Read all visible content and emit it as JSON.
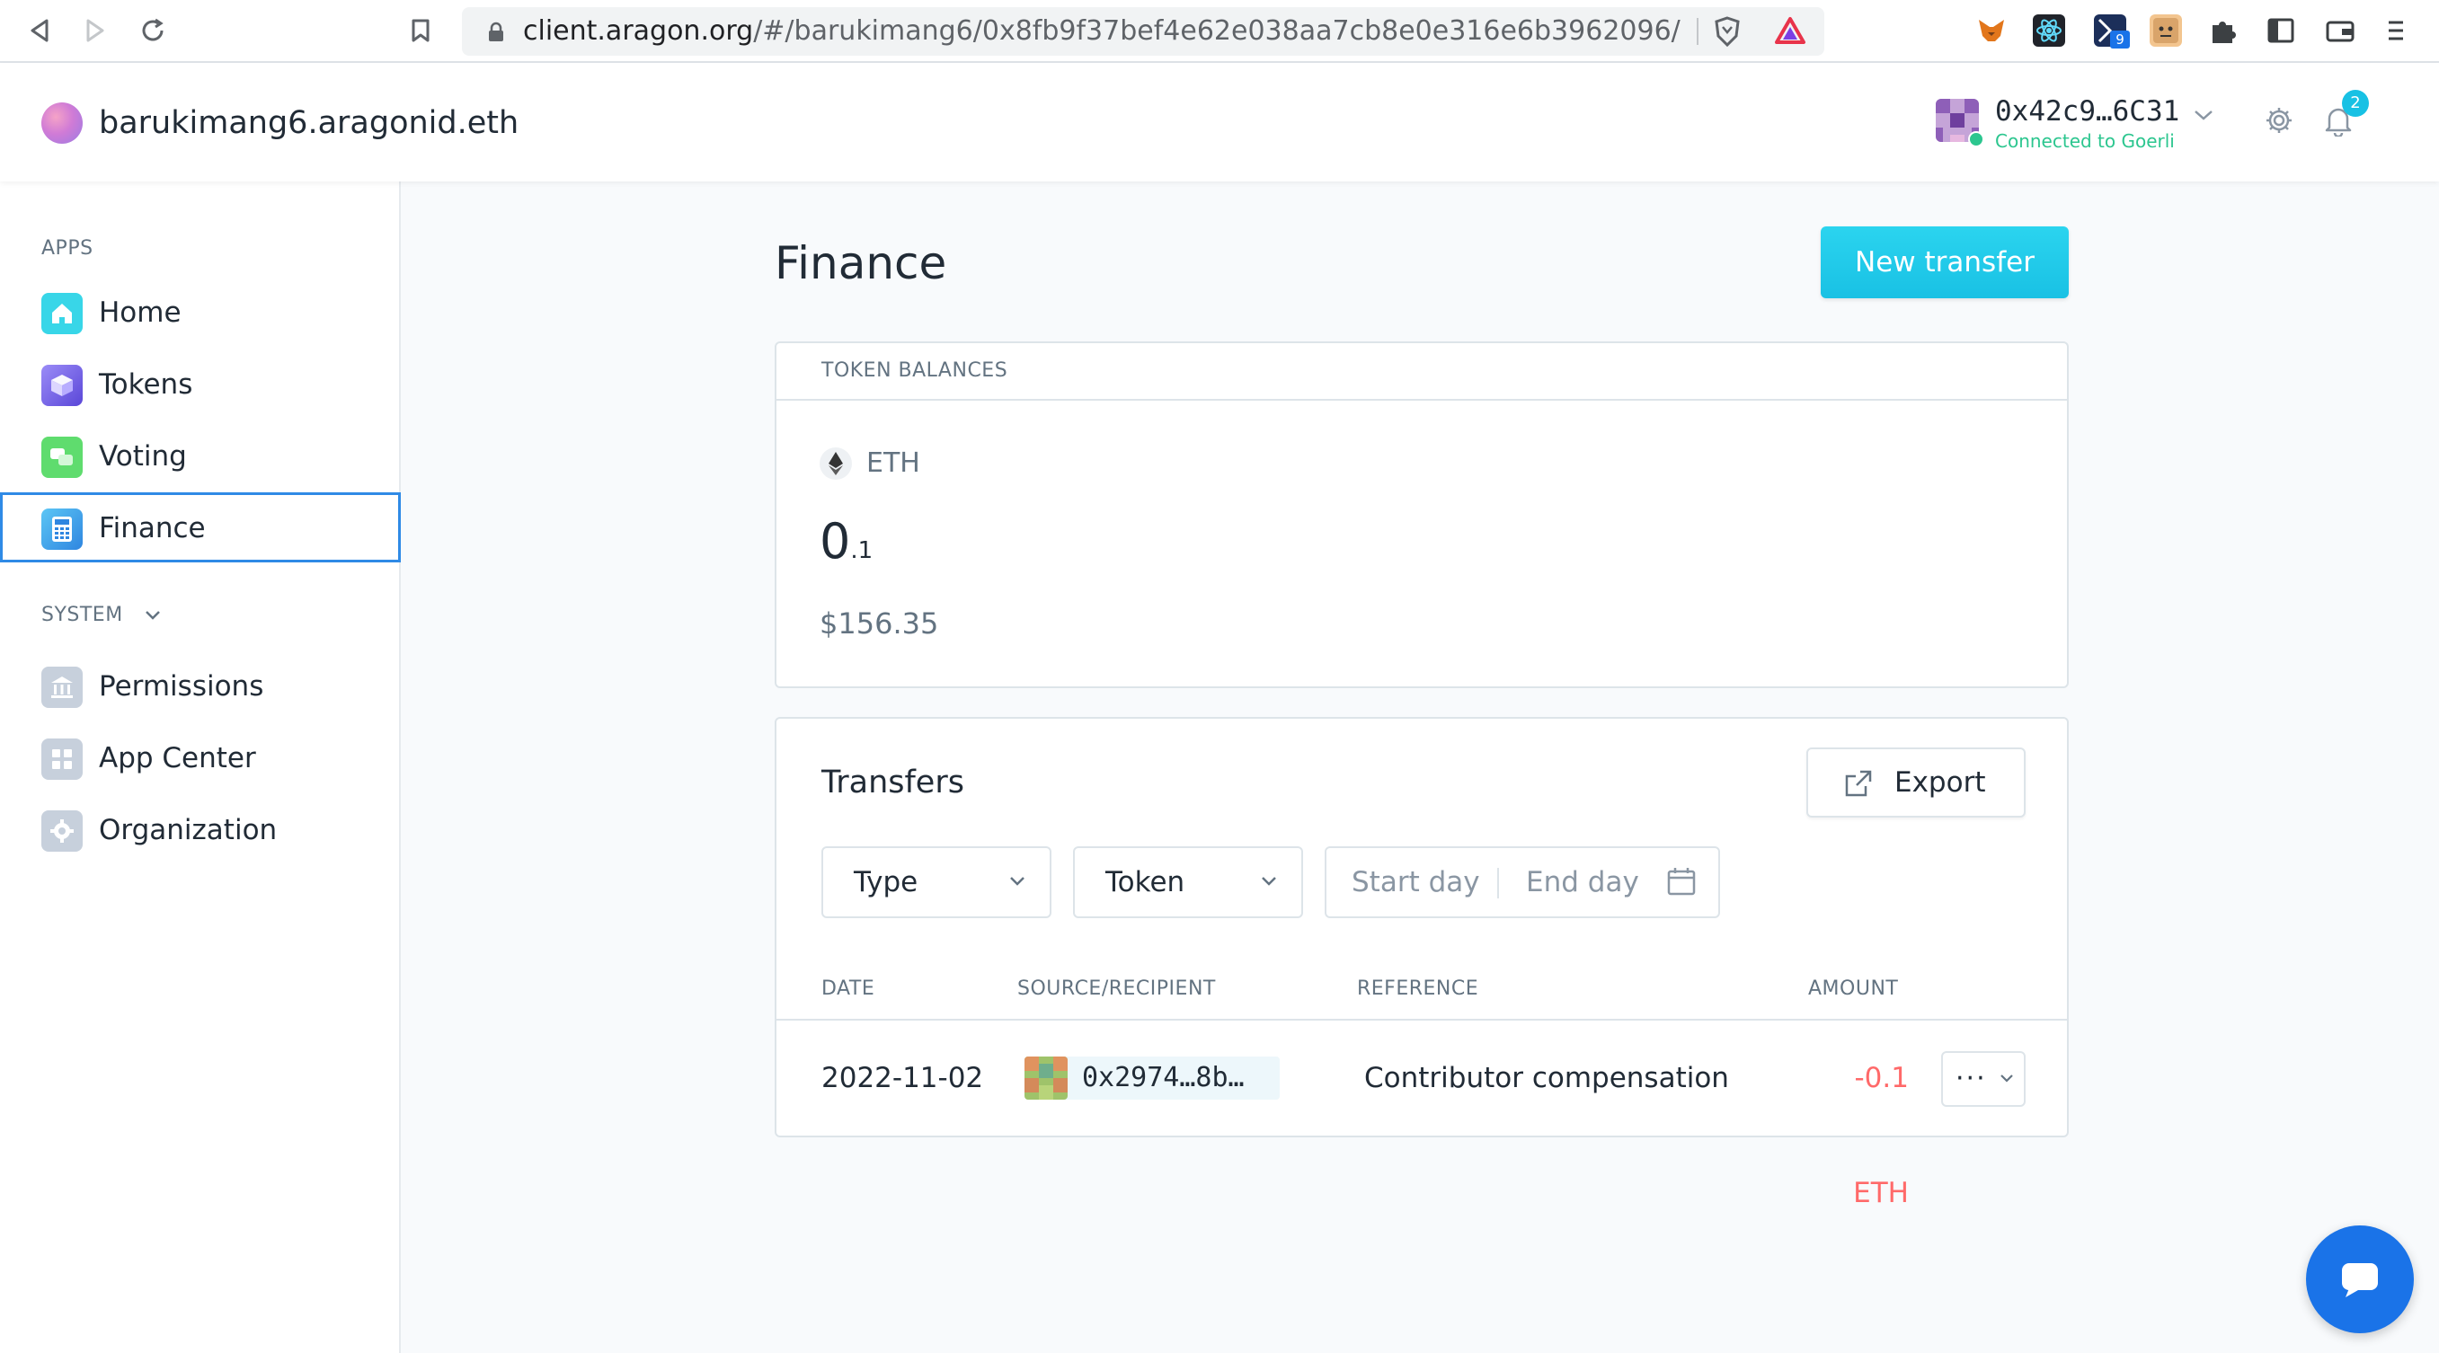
{
  "browser": {
    "url_host": "client.aragon.org",
    "url_path": "/#/barukimang6/0x8fb9f37bef4e62e038aa7cb8e0e316e6b3962096/",
    "extensions": [
      "metamask-icon",
      "react-devtools-icon",
      "extension-badge-icon",
      "extension-face-icon",
      "puzzle-icon",
      "sidebar-icon",
      "wallet-icon",
      "menu-icon"
    ],
    "extension_badge": "9"
  },
  "header": {
    "org_name": "barukimang6.aragonid.eth",
    "account_address": "0x42c9…6C31",
    "network_status": "Connected to Goerli",
    "notification_count": "2"
  },
  "sidebar": {
    "apps_label": "APPS",
    "apps": [
      {
        "label": "Home",
        "icon": "home-icon",
        "color": "#38d6e8"
      },
      {
        "label": "Tokens",
        "icon": "tokens-icon",
        "color": "#7b6cf0"
      },
      {
        "label": "Voting",
        "icon": "voting-icon",
        "color": "#5fdc6e"
      },
      {
        "label": "Finance",
        "icon": "calculator-icon",
        "color": "#3aa0f0",
        "active": true
      }
    ],
    "system_label": "SYSTEM",
    "system": [
      {
        "label": "Permissions",
        "icon": "bank-icon"
      },
      {
        "label": "App Center",
        "icon": "grid-icon"
      },
      {
        "label": "Organization",
        "icon": "gear-icon"
      }
    ]
  },
  "main": {
    "title": "Finance",
    "new_transfer_label": "New transfer",
    "token_balances": {
      "heading": "TOKEN BALANCES",
      "symbol": "ETH",
      "amount_int": "0",
      "amount_dec": ".1",
      "usd_value": "$156.35"
    },
    "transfers": {
      "title": "Transfers",
      "export_label": "Export",
      "filters": {
        "type": "Type",
        "token": "Token",
        "start_day": "Start day",
        "end_day": "End day"
      },
      "columns": [
        "DATE",
        "SOURCE/RECIPIENT",
        "REFERENCE",
        "AMOUNT"
      ],
      "rows": [
        {
          "date": "2022-11-02",
          "address": "0x2974…8b…",
          "reference": "Contributor compensation",
          "amount": "-0.1 ETH"
        }
      ]
    }
  },
  "colors": {
    "accent": "#18c1e4",
    "active_border": "#2f8ae6",
    "negative": "#ff6969",
    "connected": "#2cc68f"
  }
}
